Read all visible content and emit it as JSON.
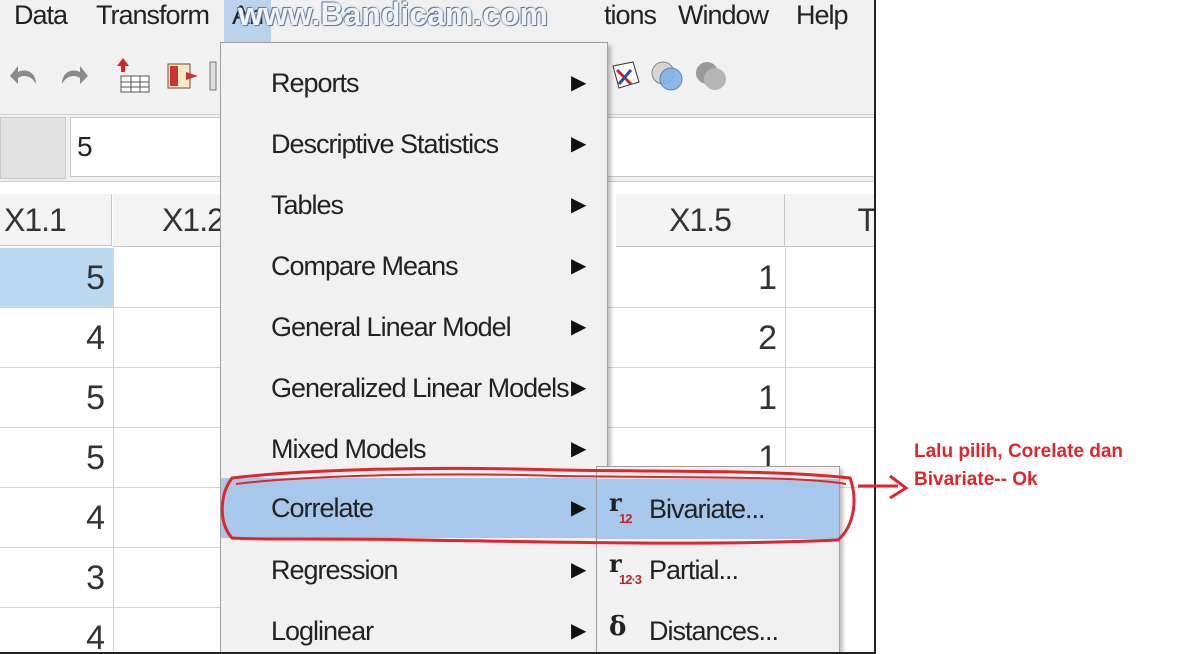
{
  "menubar": {
    "items": [
      "Data",
      "Transform",
      "An",
      "tions",
      "Window",
      "Help"
    ]
  },
  "watermark": "www.Bandicam.com",
  "cell_input": {
    "name": "",
    "value": "5"
  },
  "grid": {
    "headers": [
      "X1.1",
      "X1.2",
      "X1.5",
      "T"
    ],
    "x11_values": [
      "5",
      "4",
      "5",
      "5",
      "4",
      "3",
      "4"
    ],
    "x15_values": [
      "1",
      "2",
      "1",
      "1"
    ]
  },
  "analyze_menu": {
    "items": [
      {
        "label": "Reports",
        "arrow": "▶"
      },
      {
        "label": "Descriptive Statistics",
        "arrow": "▶"
      },
      {
        "label": "Tables",
        "arrow": "▶"
      },
      {
        "label": "Compare Means",
        "arrow": "▶"
      },
      {
        "label": "General Linear Model",
        "arrow": "▶"
      },
      {
        "label": "Generalized Linear Models",
        "arrow": "▶"
      },
      {
        "label": "Mixed Models",
        "arrow": "▶"
      },
      {
        "label": "Correlate",
        "arrow": "▶"
      },
      {
        "label": "Regression",
        "arrow": "▶"
      },
      {
        "label": "Loglinear",
        "arrow": "▶"
      }
    ],
    "highlighted": "Correlate"
  },
  "correlate_submenu": {
    "items": [
      {
        "icon": "r",
        "icon_sub": "12",
        "label": "Bivariate..."
      },
      {
        "icon": "r",
        "icon_sub": "12·3",
        "label": "Partial..."
      },
      {
        "icon": "δ",
        "icon_sub": "",
        "label": "Distances..."
      }
    ],
    "highlighted": "Bivariate..."
  },
  "annotation": {
    "line1": "Lalu pilih, Corelate dan",
    "line2": "Bivariate-- Ok",
    "color": "#e0252b"
  },
  "colors": {
    "menu_highlight": "#a7c8ea",
    "selected_cell": "#bcd9f2",
    "annotation_red": "#e0252b"
  }
}
